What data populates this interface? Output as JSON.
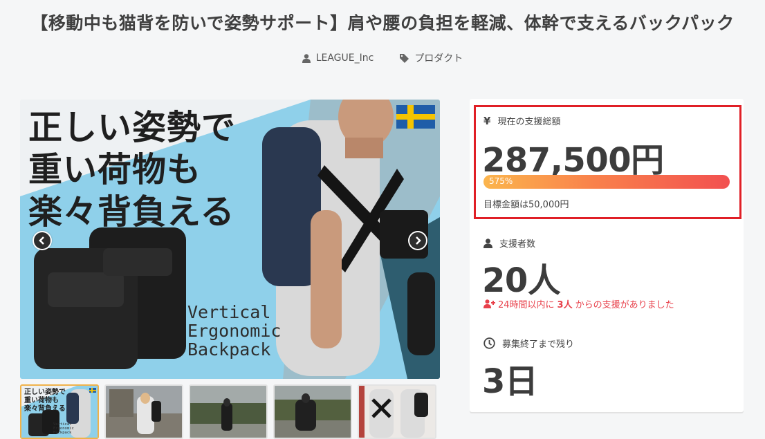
{
  "page": {
    "title": "【移動中も猫背を防いで姿勢サポート】肩や腰の負担を軽減、体幹で支えるバックパック",
    "author": "LEAGUE_Inc",
    "category": "プロダクト"
  },
  "gallery": {
    "hero_text": [
      "正しい姿勢で",
      "重い荷物も",
      "楽々背負える"
    ],
    "brand_text": [
      "Vertical",
      "Ergonomic",
      "Backpack"
    ],
    "thumb_hero_text": [
      "正しい姿勢で",
      "重い荷物も",
      "楽々背負える"
    ],
    "thumb_brand_text": [
      "Vertical",
      "Ergonomic",
      "Backpack"
    ],
    "prev_icon": "chevron-left-icon",
    "next_icon": "chevron-right-icon",
    "active_thumb": 1,
    "thumb_count": 5
  },
  "stats": {
    "total": {
      "label": "現在の支援総額",
      "icon": "yen-icon",
      "value": "287,500円",
      "progress_label": "575%",
      "progress_percent": 100,
      "goal": "目標金額は50,000円"
    },
    "backers": {
      "label": "支援者数",
      "icon": "user-icon",
      "value": "20人",
      "recent_prefix": "24時間以内に",
      "recent_count": "3人",
      "recent_suffix": "からの支援がありました"
    },
    "remaining": {
      "label": "募集終了まで残り",
      "icon": "clock-icon",
      "value": "3日"
    }
  },
  "colors": {
    "highlight_border": "#e01f26",
    "progress_start": "#fbb54d",
    "progress_end": "#f25050",
    "recent_text": "#e8414b",
    "active_thumb_border": "#f0b24a"
  }
}
